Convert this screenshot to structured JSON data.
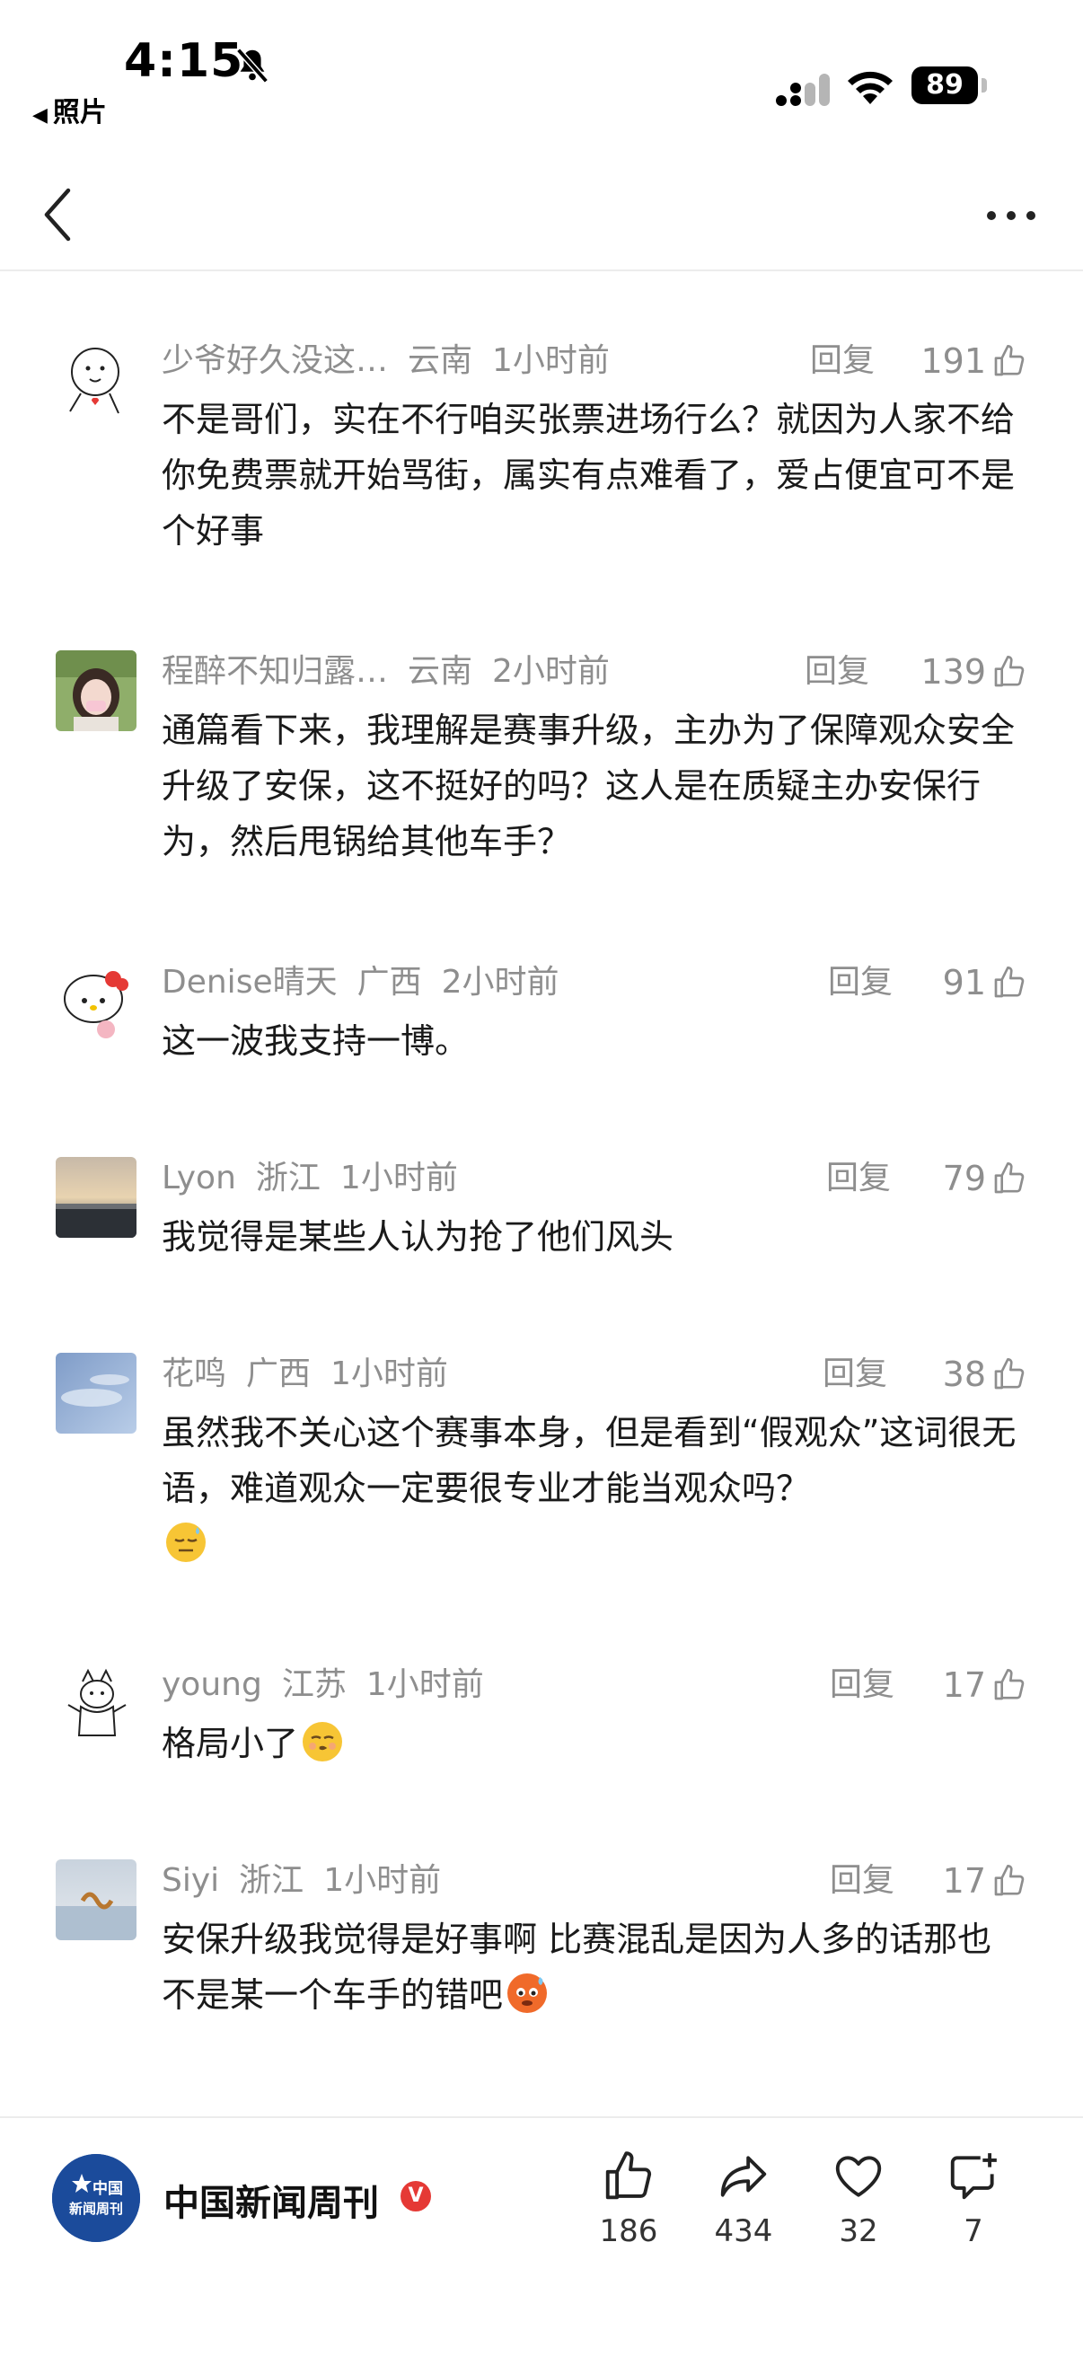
{
  "status_bar": {
    "time": "4:15",
    "back_app": "照片",
    "battery": "89"
  },
  "comments": [
    {
      "user": "少爷好久没这…",
      "location": "云南",
      "time": "1小时前",
      "reply": "回复",
      "likes": "191",
      "text": "不是哥们，实在不行咱买张票进场行么？就因为人家不给你免费票就开始骂街，属实有点难看了，爱占便宜可不是个好事"
    },
    {
      "user": "程醉不知归露…",
      "location": "云南",
      "time": "2小时前",
      "reply": "回复",
      "likes": "139",
      "text": "通篇看下来，我理解是赛事升级，主办为了保障观众安全升级了安保，这不挺好的吗？这人是在质疑主办安保行为，然后甩锅给其他车手？"
    },
    {
      "user": "Denise晴天",
      "location": "广西",
      "time": "2小时前",
      "reply": "回复",
      "likes": "91",
      "text": "这一波我支持一博。"
    },
    {
      "user": "Lyon",
      "location": "浙江",
      "time": "1小时前",
      "reply": "回复",
      "likes": "79",
      "text": "我觉得是某些人认为抢了他们风头"
    },
    {
      "user": "花鸣",
      "location": "广西",
      "time": "1小时前",
      "reply": "回复",
      "likes": "38",
      "text": "虽然我不关心这个赛事本身，但是看到“假观众”这词很无语，难道观众一定要很专业才能当观众吗？"
    },
    {
      "user": "young",
      "location": "江苏",
      "time": "1小时前",
      "reply": "回复",
      "likes": "17",
      "text": "格局小了"
    },
    {
      "user": "Siyi",
      "location": "浙江",
      "time": "1小时前",
      "reply": "回复",
      "likes": "17",
      "text": "安保升级我觉得是好事啊 比赛混乱是因为人多的话那也不是某一个车手的错吧"
    }
  ],
  "bottom_bar": {
    "publisher": "中国新闻周刊",
    "logo_text": "中国新闻周刊",
    "like_count": "186",
    "share_count": "434",
    "favorite_count": "32",
    "comment_count": "7"
  },
  "colors": {
    "meta_gray": "#8e8e8e",
    "text": "#1a1a1a",
    "publisher_blue": "#1b4b9b",
    "verified_red": "#e53935"
  }
}
